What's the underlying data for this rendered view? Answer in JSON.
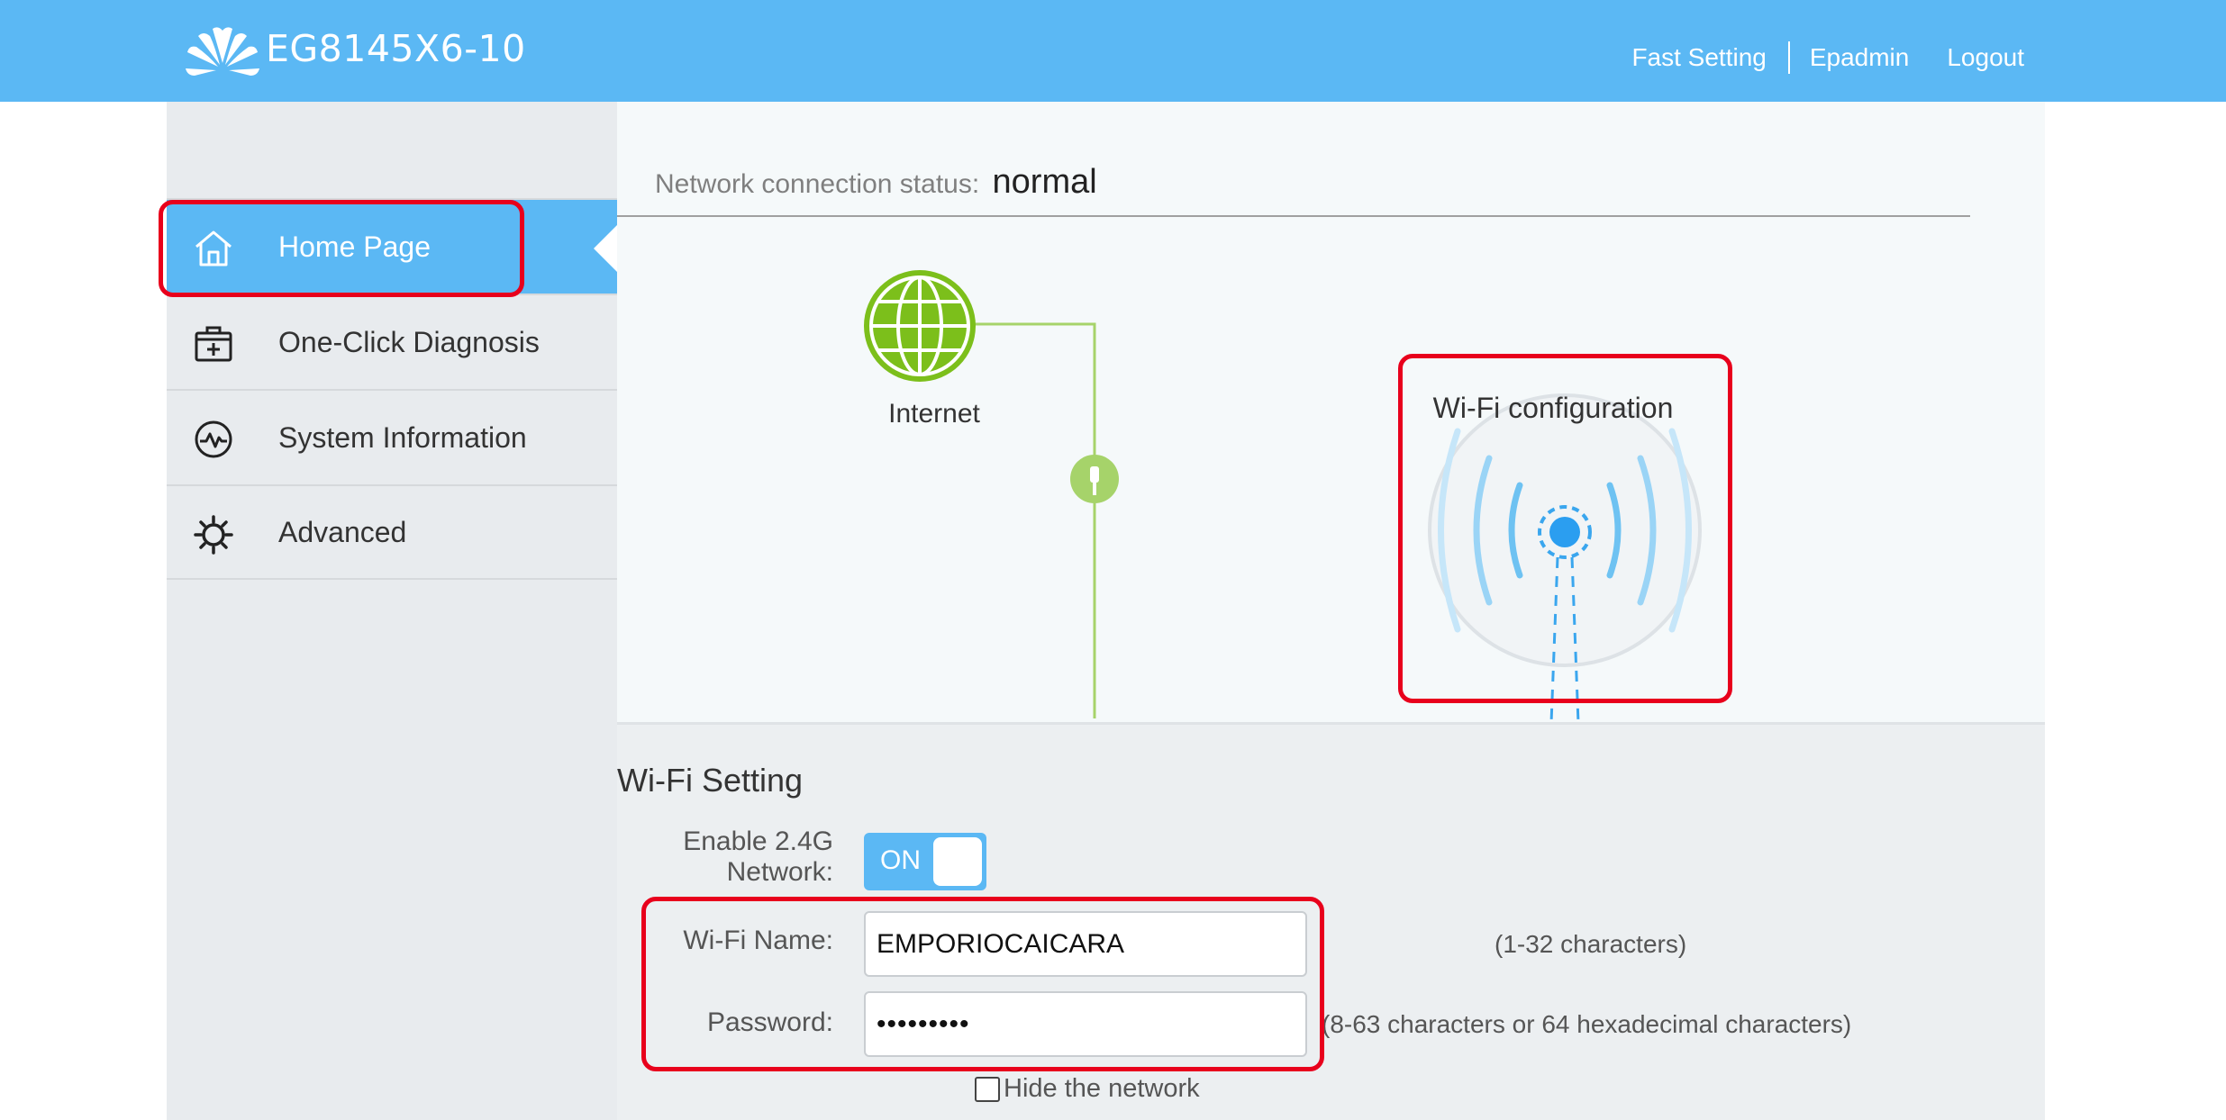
{
  "header": {
    "model": "EG8145X6-10",
    "links": [
      "Fast Setting",
      "Epadmin",
      "Logout"
    ],
    "logo_icon": "huawei-logo-icon",
    "bg_color": "#5bb8f4"
  },
  "sidebar": {
    "items": [
      {
        "label": "Home Page",
        "icon": "home-icon",
        "active": true
      },
      {
        "label": "One-Click Diagnosis",
        "icon": "first-aid-kit-icon",
        "active": false
      },
      {
        "label": "System Information",
        "icon": "pulse-icon",
        "active": false
      },
      {
        "label": "Advanced",
        "icon": "gear-icon",
        "active": false
      }
    ]
  },
  "status": {
    "label": "Network connection status:",
    "value": "normal",
    "internet_label": "Internet",
    "wifi_config_label": "Wi-Fi configuration"
  },
  "wifi": {
    "title": "Wi-Fi Setting",
    "enable_label_line1": "Enable 2.4G",
    "enable_label_line2": "Network:",
    "toggle_text": "ON",
    "name_label": "Wi-Fi Name:",
    "name_value": "EMPORIOCAICARA",
    "name_hint": "(1-32 characters)",
    "password_label": "Password:",
    "password_value": "•••••••••",
    "password_hint": "(8-63 characters or 64 hexadecimal characters)",
    "hide_label": "Hide the network"
  },
  "colors": {
    "accent": "#5bb8f4",
    "highlight": "#e8001c",
    "internet_green": "#7cbf1b"
  }
}
